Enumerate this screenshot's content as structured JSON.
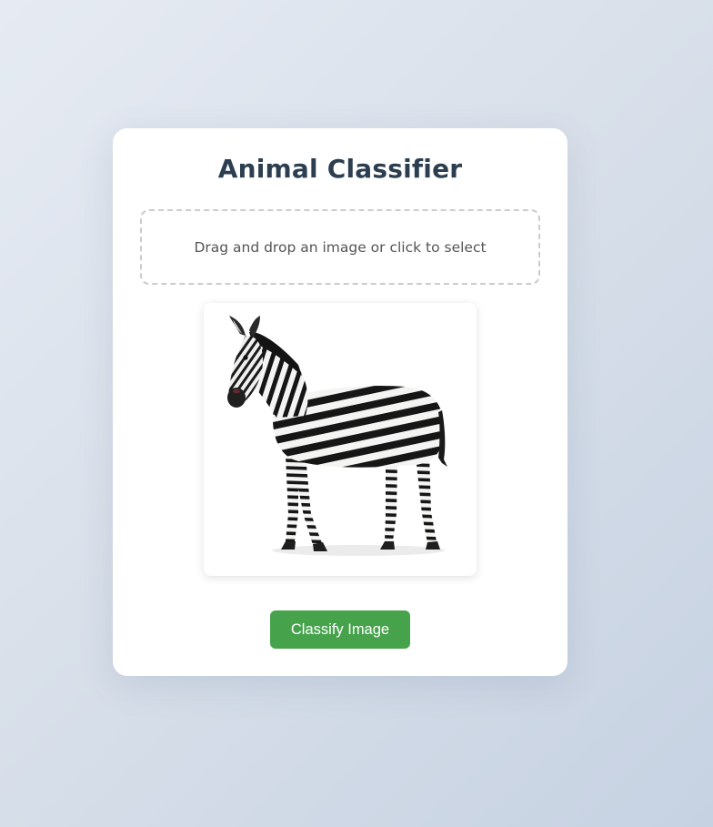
{
  "app": {
    "title": "Animal Classifier"
  },
  "dropzone": {
    "text": "Drag and drop an image or click to select"
  },
  "preview": {
    "subject": "zebra",
    "alt": "Uploaded image preview"
  },
  "actions": {
    "classify_label": "Classify Image"
  },
  "colors": {
    "accent": "#46a34c",
    "title": "#2c3e50",
    "dropzone_border": "#cccccc"
  }
}
